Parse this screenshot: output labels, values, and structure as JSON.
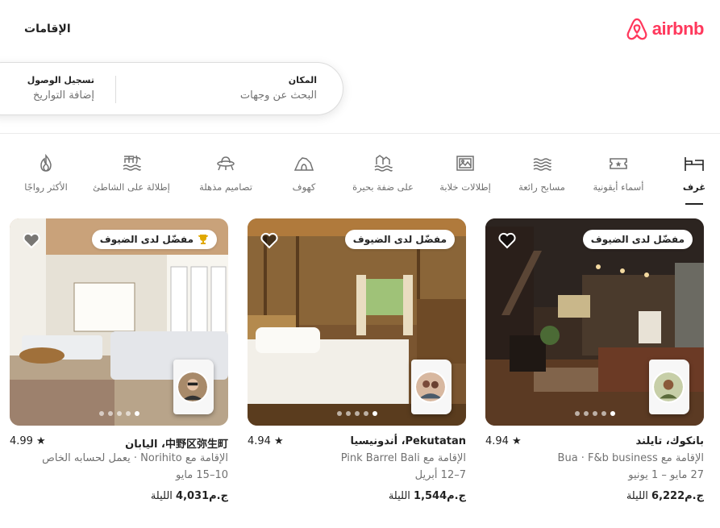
{
  "header": {
    "brand": "airbnb",
    "tab_label": "الإقامات",
    "brand_color": "#ff385c"
  },
  "search": {
    "place_title": "المكان",
    "place_placeholder": "البحث عن وجهات",
    "checkin_title": "تسجيل الوصول",
    "checkin_placeholder": "إضافة التواريخ"
  },
  "categories": [
    {
      "label": "غرف",
      "icon": "rooms-icon",
      "active": true
    },
    {
      "label": "أسماء أيقونية",
      "icon": "ticket-icon",
      "active": false
    },
    {
      "label": "مسابح رائعة",
      "icon": "pool-icon",
      "active": false
    },
    {
      "label": "إطلالات خلابة",
      "icon": "picture-icon",
      "active": false
    },
    {
      "label": "على ضفة بحيرة",
      "icon": "lake-icon",
      "active": false
    },
    {
      "label": "كهوف",
      "icon": "cave-icon",
      "active": false
    },
    {
      "label": "تصاميم مذهلة",
      "icon": "ufo-icon",
      "active": false
    },
    {
      "label": "إطلالة على الشاطئ",
      "icon": "beach-icon",
      "active": false
    },
    {
      "label": "الأكثر رواجًا",
      "icon": "flame-icon",
      "active": false
    }
  ],
  "listings": [
    {
      "badge": "مفضّل لدى الضيوف",
      "title": "بانكوك، تايلند",
      "rating": "4.94",
      "line1": "الإقامة مع Bua · F&b business",
      "line2": "27 مايو – 1 يونيو",
      "price": "ج.م6,222",
      "price_suffix": "الليلة"
    },
    {
      "badge": "مفضّل لدى الضيوف",
      "title": "Pekutatan، أندونيسيا",
      "rating": "4.94",
      "line1": "الإقامة مع Pink Barrel Bali",
      "line2": "7–12 أبريل",
      "price": "ج.م1,544",
      "price_suffix": "الليلة"
    },
    {
      "badge": "مفضّل لدى الضيوف",
      "title": "中野区弥生町، اليابان",
      "rating": "4.99",
      "line1": "الإقامة مع Norihito · يعمل لحسابه الخاص",
      "line2": "10–15 مايو",
      "price": "ج.م4,031",
      "price_suffix": "الليلة"
    }
  ]
}
